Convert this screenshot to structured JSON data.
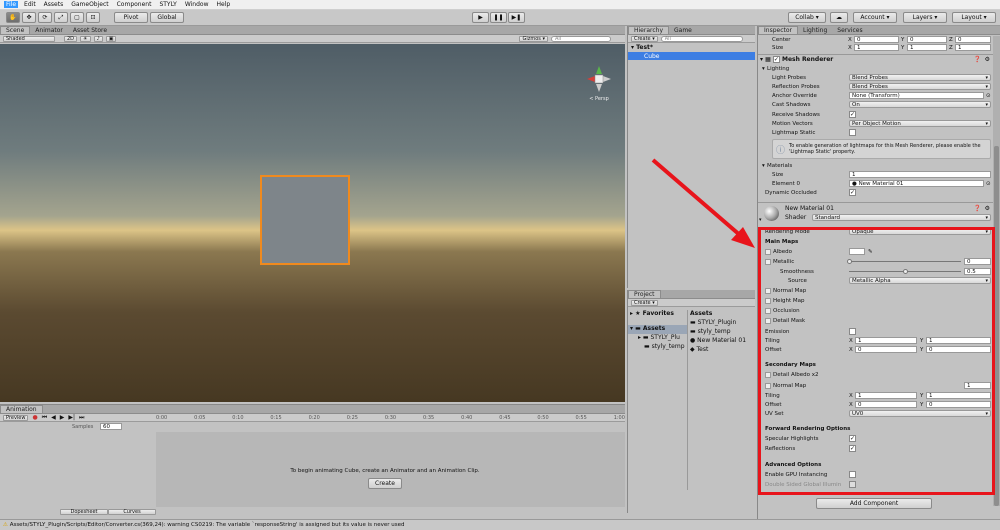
{
  "menu": [
    "File",
    "Edit",
    "Assets",
    "GameObject",
    "Component",
    "STYLY",
    "Window",
    "Help"
  ],
  "toolbar": {
    "pivot": "Pivot",
    "global": "Global",
    "collab": "Collab ▾",
    "cloud": "☁",
    "account": "Account ▾",
    "layers": "Layers ▾",
    "layout": "Layout ▾"
  },
  "scene": {
    "tab_scene": "Scene",
    "tab_animator": "Animator",
    "tab_asset_store": "Asset Store",
    "shaded": "Shaded",
    "mode2d": "2D",
    "gizmos": "Gizmos ▾",
    "search_placeholder": "All",
    "persp": "< Persp"
  },
  "hierarchy": {
    "tab": "Hierarchy",
    "tab_game": "Game",
    "create": "Create ▾",
    "search_placeholder": "All",
    "scene_name": "Test*",
    "items": [
      "Cube"
    ]
  },
  "project": {
    "tab": "Project",
    "create": "Create ▾",
    "favorites": "Favorites",
    "assets": "Assets",
    "tree": [
      "Assets",
      "STYLY_Plu",
      "styly_temp"
    ],
    "files": [
      "STYLY_Plugin",
      "styly_temp",
      "New Material 01",
      "Test"
    ]
  },
  "animation": {
    "tab": "Animation",
    "preview": "Preview",
    "samples_label": "Samples",
    "samples": "60",
    "ticks": [
      "0:00",
      "0:05",
      "0:10",
      "0:15",
      "0:20",
      "0:25",
      "0:30",
      "0:35",
      "0:40",
      "0:45",
      "0:50",
      "0:55",
      "1:00"
    ],
    "message": "To begin animating Cube, create an Animator and an Animation Clip.",
    "create": "Create",
    "dopesheet": "Dopesheet",
    "curves": "Curves"
  },
  "status": {
    "message": "Assets/STYLY_Plugin/Scripts/Editor/Converter.cs(369,24): warning CS0219: The variable `responseString' is assigned but its value is never used"
  },
  "inspector": {
    "tabs": [
      "Inspector",
      "Lighting",
      "Services"
    ],
    "center": {
      "label": "Center",
      "x": "0",
      "y": "0",
      "z": "0"
    },
    "size": {
      "label": "Size",
      "x": "1",
      "y": "1",
      "z": "1"
    },
    "mesh_renderer": "Mesh Renderer",
    "lighting_hdr": "Lighting",
    "light_probes": {
      "label": "Light Probes",
      "value": "Blend Probes"
    },
    "reflection_probes": {
      "label": "Reflection Probes",
      "value": "Blend Probes"
    },
    "anchor_override": {
      "label": "Anchor Override",
      "value": "None (Transform)"
    },
    "cast_shadows": {
      "label": "Cast Shadows",
      "value": "On"
    },
    "receive_shadows": "Receive Shadows",
    "motion_vectors": {
      "label": "Motion Vectors",
      "value": "Per Object Motion"
    },
    "lightmap_static": "Lightmap Static",
    "info": "To enable generation of lightmaps for this Mesh Renderer, please enable the 'Lightmap Static' property.",
    "materials_hdr": "Materials",
    "mat_size": {
      "label": "Size",
      "value": "1"
    },
    "element0": {
      "label": "Element 0",
      "value": "New Material 01"
    },
    "dynamic_occluded": "Dynamic Occluded",
    "material_name": "New Material 01",
    "shader_label": "Shader",
    "shader_value": "Standard",
    "rendering_mode": {
      "label": "Rendering Mode",
      "value": "Opaque"
    },
    "main_maps": "Main Maps",
    "albedo": "Albedo",
    "metallic": {
      "label": "Metallic",
      "value": "0"
    },
    "smoothness": {
      "label": "Smoothness",
      "value": "0.5"
    },
    "source": {
      "label": "Source",
      "value": "Metallic Alpha"
    },
    "normal_map": "Normal Map",
    "height_map": "Height Map",
    "occlusion": "Occlusion",
    "detail_mask": "Detail Mask",
    "emission": "Emission",
    "tiling1": {
      "label": "Tiling",
      "x": "1",
      "y": "1"
    },
    "offset1": {
      "label": "Offset",
      "x": "0",
      "y": "0"
    },
    "secondary_maps": "Secondary Maps",
    "detail_albedo": "Detail Albedo x2",
    "normal_map2": {
      "label": "Normal Map",
      "value": "1"
    },
    "tiling2": {
      "label": "Tiling",
      "x": "1",
      "y": "1"
    },
    "offset2": {
      "label": "Offset",
      "x": "0",
      "y": "0"
    },
    "uv_set": {
      "label": "UV Set",
      "value": "UV0"
    },
    "forward_hdr": "Forward Rendering Options",
    "specular": "Specular Highlights",
    "reflections": "Reflections",
    "advanced_hdr": "Advanced Options",
    "gpu_instancing": "Enable GPU Instancing",
    "double_sided": "Double Sided Global Illumin",
    "add_component": "Add Component"
  },
  "colors": {
    "highlight_box": "#e8141b",
    "arrow": "#e8141b",
    "selection": "#3d7ee3",
    "cube_outline": "#f08a1e"
  }
}
